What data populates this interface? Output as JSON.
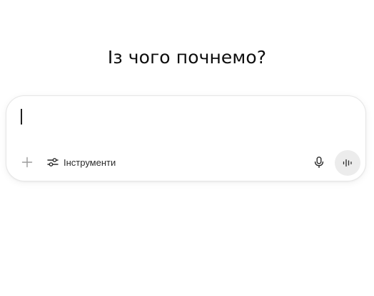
{
  "main": {
    "heading": "Із чого почнемо?"
  },
  "composer": {
    "input_value": "",
    "toolbar": {
      "plus_icon": "plus-icon",
      "tools_icon": "sliders-icon",
      "tools_label": "Інструменти",
      "mic_icon": "microphone-icon",
      "voice_icon": "voice-waveform-icon"
    }
  },
  "colors": {
    "background": "#ffffff",
    "text": "#0d0d0d",
    "voice_button_bg": "#ececec",
    "composer_border": "#e6e6e6"
  }
}
